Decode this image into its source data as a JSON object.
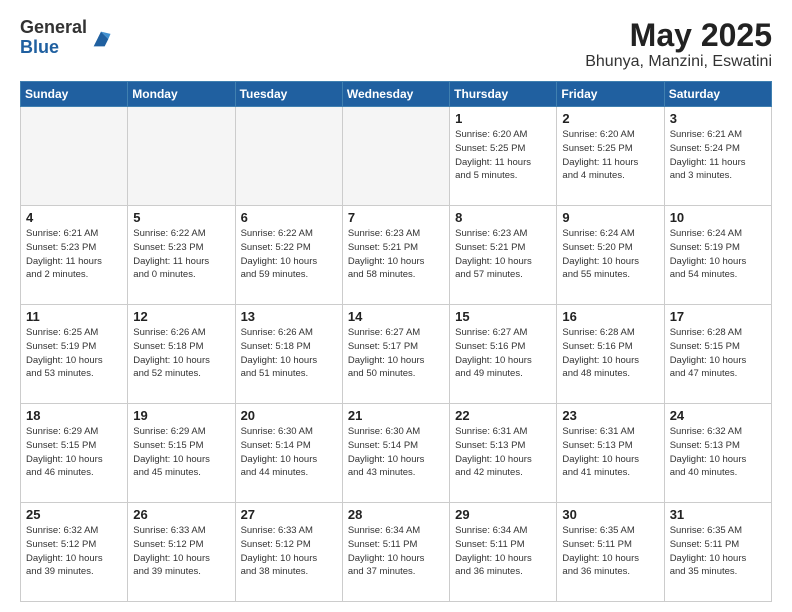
{
  "logo": {
    "general": "General",
    "blue": "Blue"
  },
  "header": {
    "title": "May 2025",
    "subtitle": "Bhunya, Manzini, Eswatini"
  },
  "weekdays": [
    "Sunday",
    "Monday",
    "Tuesday",
    "Wednesday",
    "Thursday",
    "Friday",
    "Saturday"
  ],
  "weeks": [
    [
      {
        "day": "",
        "info": ""
      },
      {
        "day": "",
        "info": ""
      },
      {
        "day": "",
        "info": ""
      },
      {
        "day": "",
        "info": ""
      },
      {
        "day": "1",
        "info": "Sunrise: 6:20 AM\nSunset: 5:25 PM\nDaylight: 11 hours\nand 5 minutes."
      },
      {
        "day": "2",
        "info": "Sunrise: 6:20 AM\nSunset: 5:25 PM\nDaylight: 11 hours\nand 4 minutes."
      },
      {
        "day": "3",
        "info": "Sunrise: 6:21 AM\nSunset: 5:24 PM\nDaylight: 11 hours\nand 3 minutes."
      }
    ],
    [
      {
        "day": "4",
        "info": "Sunrise: 6:21 AM\nSunset: 5:23 PM\nDaylight: 11 hours\nand 2 minutes."
      },
      {
        "day": "5",
        "info": "Sunrise: 6:22 AM\nSunset: 5:23 PM\nDaylight: 11 hours\nand 0 minutes."
      },
      {
        "day": "6",
        "info": "Sunrise: 6:22 AM\nSunset: 5:22 PM\nDaylight: 10 hours\nand 59 minutes."
      },
      {
        "day": "7",
        "info": "Sunrise: 6:23 AM\nSunset: 5:21 PM\nDaylight: 10 hours\nand 58 minutes."
      },
      {
        "day": "8",
        "info": "Sunrise: 6:23 AM\nSunset: 5:21 PM\nDaylight: 10 hours\nand 57 minutes."
      },
      {
        "day": "9",
        "info": "Sunrise: 6:24 AM\nSunset: 5:20 PM\nDaylight: 10 hours\nand 55 minutes."
      },
      {
        "day": "10",
        "info": "Sunrise: 6:24 AM\nSunset: 5:19 PM\nDaylight: 10 hours\nand 54 minutes."
      }
    ],
    [
      {
        "day": "11",
        "info": "Sunrise: 6:25 AM\nSunset: 5:19 PM\nDaylight: 10 hours\nand 53 minutes."
      },
      {
        "day": "12",
        "info": "Sunrise: 6:26 AM\nSunset: 5:18 PM\nDaylight: 10 hours\nand 52 minutes."
      },
      {
        "day": "13",
        "info": "Sunrise: 6:26 AM\nSunset: 5:18 PM\nDaylight: 10 hours\nand 51 minutes."
      },
      {
        "day": "14",
        "info": "Sunrise: 6:27 AM\nSunset: 5:17 PM\nDaylight: 10 hours\nand 50 minutes."
      },
      {
        "day": "15",
        "info": "Sunrise: 6:27 AM\nSunset: 5:16 PM\nDaylight: 10 hours\nand 49 minutes."
      },
      {
        "day": "16",
        "info": "Sunrise: 6:28 AM\nSunset: 5:16 PM\nDaylight: 10 hours\nand 48 minutes."
      },
      {
        "day": "17",
        "info": "Sunrise: 6:28 AM\nSunset: 5:15 PM\nDaylight: 10 hours\nand 47 minutes."
      }
    ],
    [
      {
        "day": "18",
        "info": "Sunrise: 6:29 AM\nSunset: 5:15 PM\nDaylight: 10 hours\nand 46 minutes."
      },
      {
        "day": "19",
        "info": "Sunrise: 6:29 AM\nSunset: 5:15 PM\nDaylight: 10 hours\nand 45 minutes."
      },
      {
        "day": "20",
        "info": "Sunrise: 6:30 AM\nSunset: 5:14 PM\nDaylight: 10 hours\nand 44 minutes."
      },
      {
        "day": "21",
        "info": "Sunrise: 6:30 AM\nSunset: 5:14 PM\nDaylight: 10 hours\nand 43 minutes."
      },
      {
        "day": "22",
        "info": "Sunrise: 6:31 AM\nSunset: 5:13 PM\nDaylight: 10 hours\nand 42 minutes."
      },
      {
        "day": "23",
        "info": "Sunrise: 6:31 AM\nSunset: 5:13 PM\nDaylight: 10 hours\nand 41 minutes."
      },
      {
        "day": "24",
        "info": "Sunrise: 6:32 AM\nSunset: 5:13 PM\nDaylight: 10 hours\nand 40 minutes."
      }
    ],
    [
      {
        "day": "25",
        "info": "Sunrise: 6:32 AM\nSunset: 5:12 PM\nDaylight: 10 hours\nand 39 minutes."
      },
      {
        "day": "26",
        "info": "Sunrise: 6:33 AM\nSunset: 5:12 PM\nDaylight: 10 hours\nand 39 minutes."
      },
      {
        "day": "27",
        "info": "Sunrise: 6:33 AM\nSunset: 5:12 PM\nDaylight: 10 hours\nand 38 minutes."
      },
      {
        "day": "28",
        "info": "Sunrise: 6:34 AM\nSunset: 5:11 PM\nDaylight: 10 hours\nand 37 minutes."
      },
      {
        "day": "29",
        "info": "Sunrise: 6:34 AM\nSunset: 5:11 PM\nDaylight: 10 hours\nand 36 minutes."
      },
      {
        "day": "30",
        "info": "Sunrise: 6:35 AM\nSunset: 5:11 PM\nDaylight: 10 hours\nand 36 minutes."
      },
      {
        "day": "31",
        "info": "Sunrise: 6:35 AM\nSunset: 5:11 PM\nDaylight: 10 hours\nand 35 minutes."
      }
    ]
  ]
}
